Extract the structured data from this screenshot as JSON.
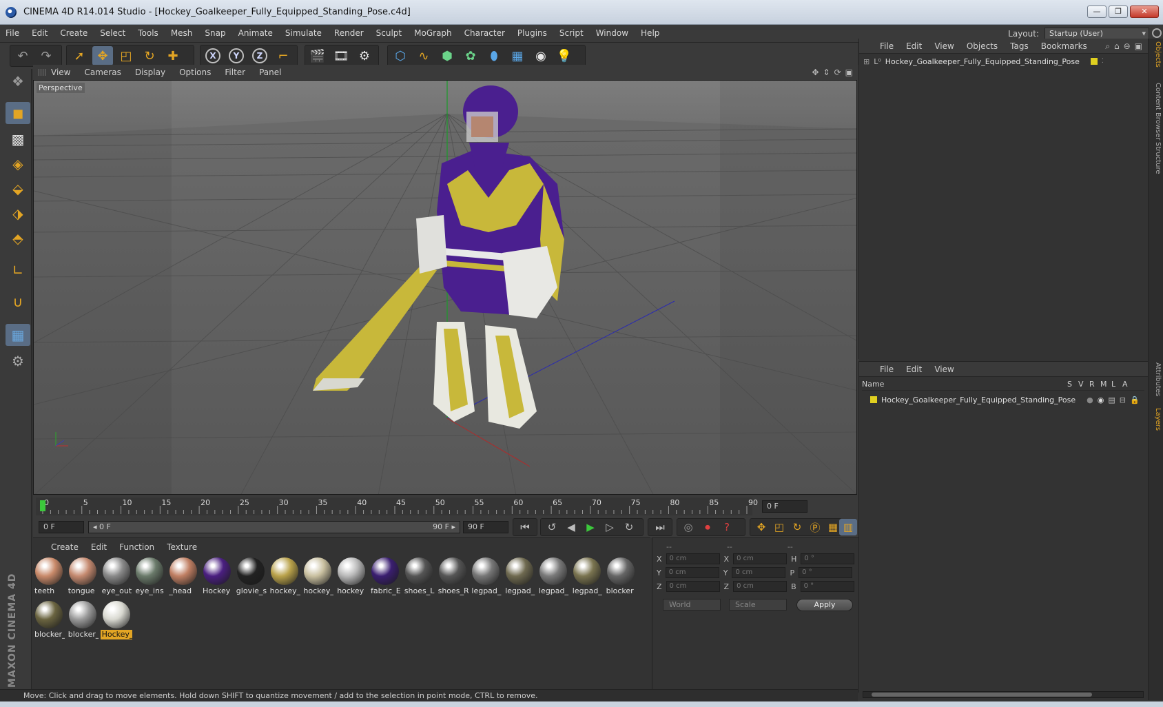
{
  "window": {
    "title": "CINEMA 4D R14.014 Studio - [Hockey_Goalkeeper_Fully_Equipped_Standing_Pose.c4d]",
    "controls": [
      "—",
      "❐",
      "✕"
    ]
  },
  "menubar": {
    "items": [
      "File",
      "Edit",
      "Create",
      "Select",
      "Tools",
      "Mesh",
      "Snap",
      "Animate",
      "Simulate",
      "Render",
      "Sculpt",
      "MoGraph",
      "Character",
      "Plugins",
      "Script",
      "Window",
      "Help"
    ],
    "layout_label": "Layout:",
    "layout_value": "Startup (User)"
  },
  "viewport": {
    "menu": [
      "View",
      "Cameras",
      "Display",
      "Options",
      "Filter",
      "Panel"
    ],
    "label": "Perspective"
  },
  "timeline": {
    "ticks": [
      "0",
      "5",
      "10",
      "15",
      "20",
      "25",
      "30",
      "35",
      "40",
      "45",
      "50",
      "55",
      "60",
      "65",
      "70",
      "75",
      "80",
      "85",
      "90"
    ],
    "current_frame_right": "0 F",
    "start_frame": "0 F",
    "range_start": "◂ 0 F",
    "range_end": "90 F ▸",
    "end_frame": "90 F"
  },
  "materials": {
    "menu": [
      "Create",
      "Edit",
      "Function",
      "Texture"
    ],
    "items": [
      {
        "label": "teeth",
        "color": "#c98a6a"
      },
      {
        "label": "tongue",
        "color": "#c58a70"
      },
      {
        "label": "eye_out",
        "color": "#8a8a8a"
      },
      {
        "label": "eye_ins",
        "color": "#6a7a6a"
      },
      {
        "label": "_head",
        "color": "#c07f63"
      },
      {
        "label": "Hockey",
        "color": "#4a1f80"
      },
      {
        "label": "glovie_s",
        "color": "#222222"
      },
      {
        "label": "hockey_",
        "color": "#b9a24a"
      },
      {
        "label": "hockey_",
        "color": "#c9c0a0"
      },
      {
        "label": "hockey",
        "color": "#b8b8b8"
      },
      {
        "label": "fabric_E",
        "color": "#3a1e70"
      },
      {
        "label": "shoes_L",
        "color": "#555555"
      },
      {
        "label": "shoes_R",
        "color": "#555555"
      },
      {
        "label": "legpad_",
        "color": "#777777"
      },
      {
        "label": "legpad_",
        "color": "#6f6a50"
      },
      {
        "label": "legpad_",
        "color": "#7a7a7a"
      },
      {
        "label": "legpad_",
        "color": "#7a7450"
      },
      {
        "label": "blocker",
        "color": "#666666"
      },
      {
        "label": "blocker_",
        "color": "#6a6440"
      },
      {
        "label": "blocker_",
        "color": "#9a9a9a"
      },
      {
        "label": "Hockey_",
        "color": "#d8d8d0"
      }
    ],
    "selected_index": 20
  },
  "coordinates": {
    "header": [
      "--",
      "--",
      "--"
    ],
    "rows": [
      {
        "a": "X",
        "a_val": "0 cm",
        "b": "X",
        "b_val": "0 cm",
        "c": "H",
        "c_val": "0 °"
      },
      {
        "a": "Y",
        "a_val": "0 cm",
        "b": "Y",
        "b_val": "0 cm",
        "c": "P",
        "c_val": "0 °"
      },
      {
        "a": "Z",
        "a_val": "0 cm",
        "b": "Z",
        "b_val": "0 cm",
        "c": "B",
        "c_val": "0 °"
      }
    ],
    "mode": "World",
    "scale": "Scale",
    "apply": "Apply"
  },
  "objects": {
    "menu": [
      "File",
      "Edit",
      "View",
      "Objects",
      "Tags",
      "Bookmarks"
    ],
    "item": "Hockey_Goalkeeper_Fully_Equipped_Standing_Pose",
    "tag_color": "#e0d020"
  },
  "layers": {
    "menu": [
      "File",
      "Edit",
      "View"
    ],
    "columns": [
      "Name",
      "S",
      "V",
      "R",
      "M",
      "L",
      "A"
    ],
    "item": "Hockey_Goalkeeper_Fully_Equipped_Standing_Pose"
  },
  "side_tabs": [
    "Objects",
    "Content Browser",
    "Structure",
    "Attributes",
    "Layers"
  ],
  "status": "Move: Click and drag to move elements. Hold down SHIFT to quantize movement / add to the selection in point mode, CTRL to remove.",
  "logo": "MAXON CINEMA 4D"
}
